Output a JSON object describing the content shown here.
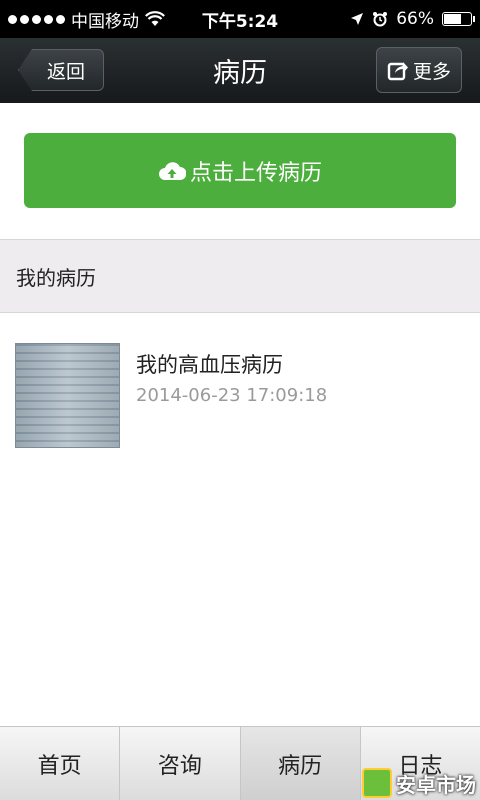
{
  "status_bar": {
    "carrier": "中国移动",
    "time": "下午5:24",
    "battery_text": "66%",
    "battery_level": 0.66
  },
  "nav": {
    "back_label": "返回",
    "title": "病历",
    "more_label": "更多"
  },
  "upload": {
    "label": "点击上传病历"
  },
  "section": {
    "title": "我的病历"
  },
  "records": [
    {
      "title": "我的高血压病历",
      "date": "2014-06-23 17:09:18"
    }
  ],
  "tabs": [
    {
      "label": "首页",
      "active": false
    },
    {
      "label": "咨询",
      "active": false
    },
    {
      "label": "病历",
      "active": true
    },
    {
      "label": "日志",
      "active": false
    }
  ],
  "watermark": {
    "text": "安卓市场"
  },
  "colors": {
    "upload_green": "#4cae3c",
    "nav_dark": "#1c2022"
  }
}
